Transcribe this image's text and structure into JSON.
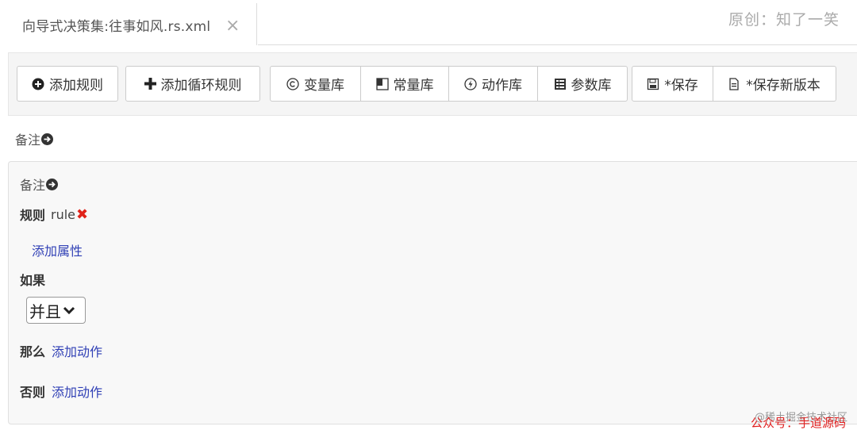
{
  "tab": {
    "title": "向导式决策集:往事如风.rs.xml",
    "close": "×"
  },
  "watermark_top": "原创：知了一笑",
  "toolbar": {
    "add_rule": "添加规则",
    "add_loop_rule": "添加循环规则",
    "variable_lib": "变量库",
    "constant_lib": "常量库",
    "action_lib": "动作库",
    "param_lib": "参数库",
    "save": "*保存",
    "save_new_version": "*保存新版本"
  },
  "remark_top": "备注",
  "rule": {
    "remark": "备注",
    "rule_label": "规则",
    "rule_name": "rule",
    "delete_mark": "✖",
    "add_property": "添加属性",
    "if_label": "如果",
    "condition_select": "并且",
    "then_label": "那么",
    "then_action": "添加动作",
    "else_label": "否则",
    "else_action": "添加动作"
  },
  "watermark_bottom": "@稀土掘金技术社区",
  "watermark_bottom2": "公众号：手道源码"
}
